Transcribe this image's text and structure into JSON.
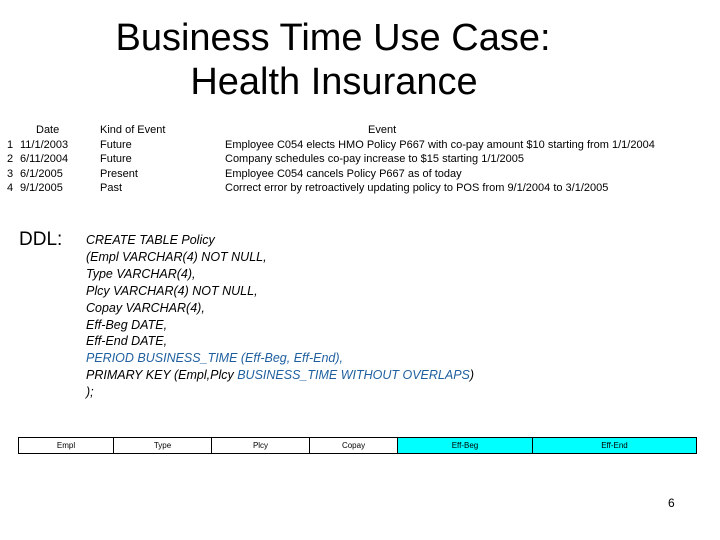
{
  "title": {
    "line1": "Business Time Use Case:",
    "line2": "Health Insurance"
  },
  "events": {
    "headers": {
      "date": "Date",
      "kind": "Kind of Event",
      "event": "Event"
    },
    "rows": [
      {
        "num": "1",
        "date": "11/1/2003",
        "kind": "Future",
        "event": "Employee C054 elects HMO Policy P667 with co-pay amount $10 starting from 1/1/2004"
      },
      {
        "num": "2",
        "date": "6/11/2004",
        "kind": "Future",
        "event": "Company schedules co-pay increase to $15 starting 1/1/2005"
      },
      {
        "num": "3",
        "date": "6/1/2005",
        "kind": "Present",
        "event": "Employee C054 cancels Policy P667 as of today"
      },
      {
        "num": "4",
        "date": "9/1/2005",
        "kind": "Past",
        "event": "Correct error by retroactively updating policy to POS from 9/1/2004 to 3/1/2005"
      }
    ]
  },
  "ddl": {
    "label": "DDL:",
    "lines": {
      "l1": "CREATE TABLE Policy",
      "l2": "(Empl VARCHAR(4) NOT NULL,",
      "l3": "Type VARCHAR(4),",
      "l4": "Plcy VARCHAR(4) NOT NULL,",
      "l5": "Copay VARCHAR(4),",
      "l6": "Eff-Beg DATE,",
      "l7": "Eff-End DATE,",
      "l8": "PERIOD BUSINESS_TIME (Eff-Beg, Eff-End),",
      "l9a": "PRIMARY KEY (Empl,Plcy ",
      "l9b": "BUSINESS_TIME WITHOUT OVERLAPS",
      "l9c": ")",
      "l10": ");"
    },
    "highlight_color": "#1f5f9f"
  },
  "columns": {
    "items": [
      "Empl",
      "Type",
      "Plcy",
      "Copay",
      "Eff-Beg",
      "Eff-End"
    ],
    "highlight_color": "#00ffff"
  },
  "page_number": "6"
}
